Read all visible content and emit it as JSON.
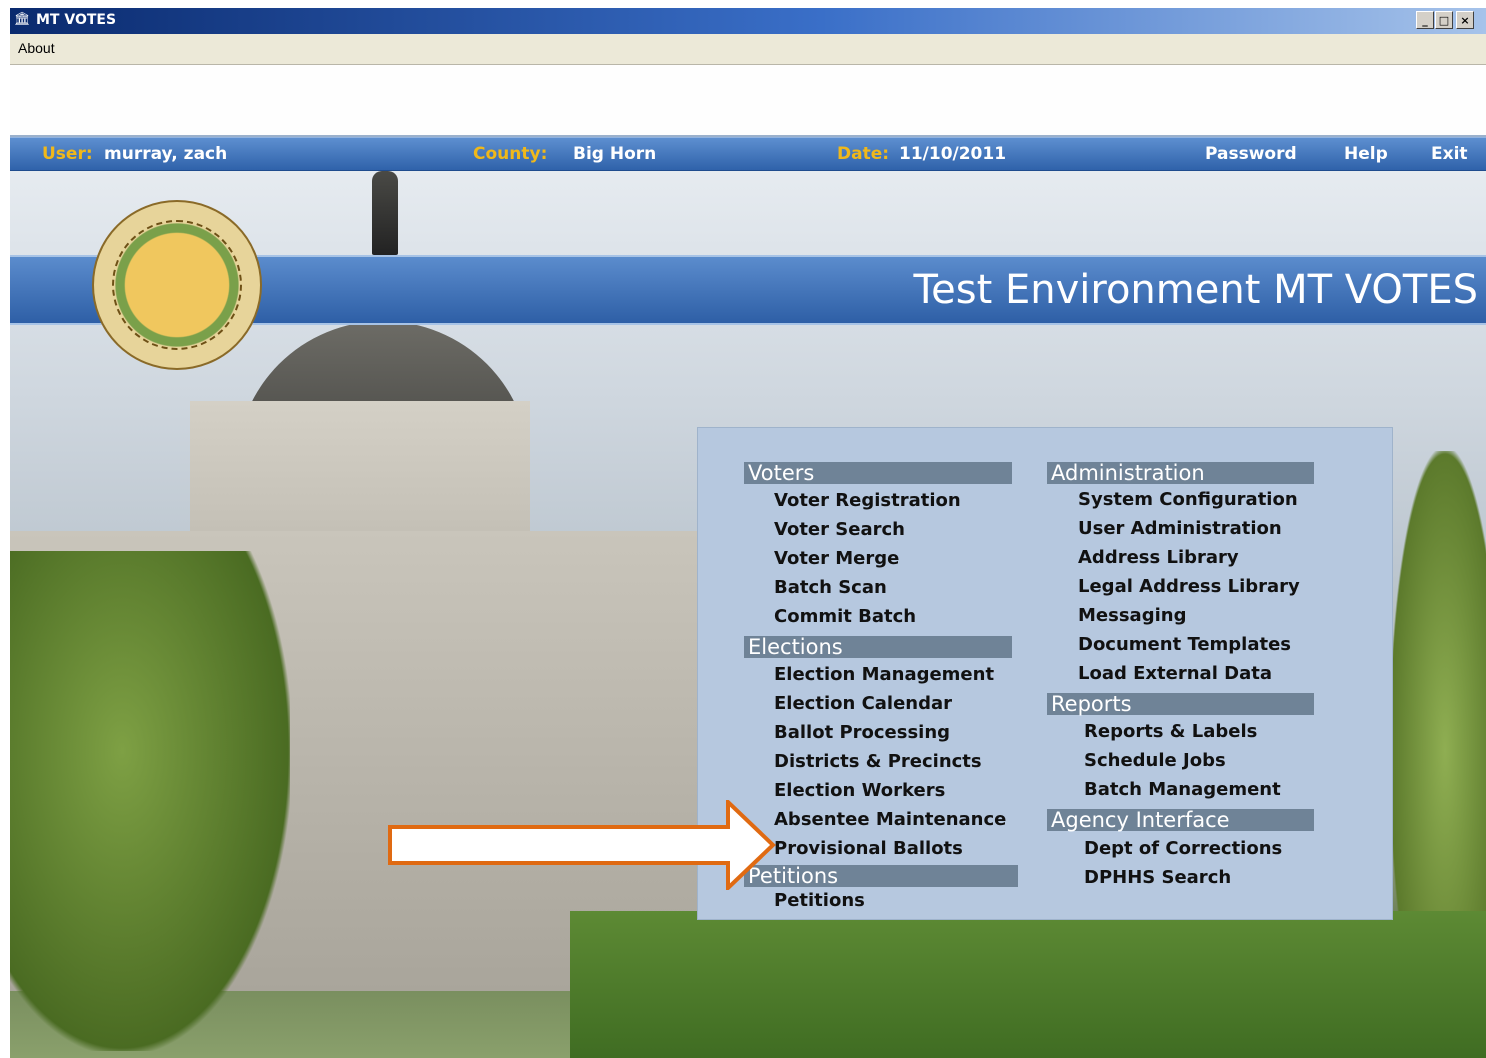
{
  "window": {
    "title": "MT VOTES",
    "controls": [
      "_",
      "□",
      "×"
    ]
  },
  "menubar": {
    "about": "About"
  },
  "userbar": {
    "user_label": "User:",
    "user_value": "murray, zach",
    "county_label": "County:",
    "county_value": "Big Horn",
    "date_label": "Date:",
    "date_value": "11/10/2011",
    "password": "Password",
    "help": "Help",
    "exit": "Exit"
  },
  "banner": {
    "title": "Test Environment MT VOTES"
  },
  "menu": {
    "voters": {
      "header": "Voters",
      "items": [
        "Voter Registration",
        "Voter Search",
        "Voter Merge",
        "Batch Scan",
        "Commit Batch"
      ]
    },
    "elections": {
      "header": "Elections",
      "items": [
        "Election Management",
        "Election Calendar",
        "Ballot Processing",
        "Districts & Precincts",
        "Election Workers",
        "Absentee Maintenance",
        "Provisional Ballots"
      ]
    },
    "petitions": {
      "header": "Petitions",
      "items": [
        "Petitions"
      ]
    },
    "administration": {
      "header": "Administration",
      "items": [
        "System Configuration",
        "User Administration",
        "Address Library",
        "Legal Address Library",
        "Messaging",
        "Document Templates",
        "Load External Data"
      ]
    },
    "reports": {
      "header": "Reports",
      "items": [
        "Reports & Labels",
        "Schedule Jobs",
        "Batch Management"
      ]
    },
    "agency": {
      "header": "Agency Interface",
      "items": [
        "Dept of Corrections",
        "DPHHS Search"
      ]
    }
  },
  "colors": {
    "accent_arrow": "#e06a12",
    "banner_blue": "#2e5fa6",
    "label_gold": "#f0b81a",
    "panel": "#b6c8df",
    "section_header": "#6f8397"
  },
  "icons": {
    "app": "capitol-icon",
    "seal": "state-seal-logo",
    "highlight": "arrow-pointer-icon"
  }
}
